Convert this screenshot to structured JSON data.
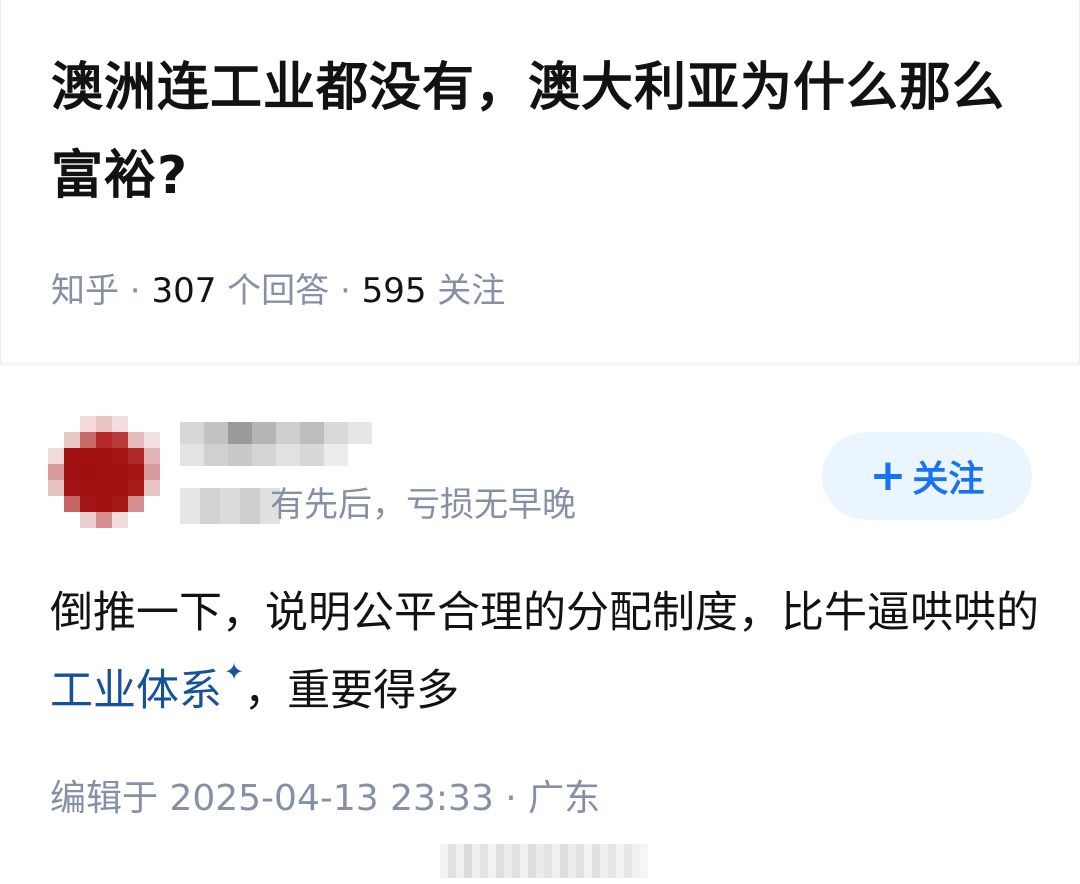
{
  "question": {
    "title": "澳洲连工业都没有，澳大利亚为什么那么富裕?",
    "source": "知乎",
    "sep1": " · ",
    "answer_count": "307",
    "answer_label": " 个回答",
    "sep2": " · ",
    "follow_count": "595",
    "follow_label": " 关注"
  },
  "author": {
    "bio_visible": "有先后，亏损无早晚"
  },
  "follow_button": {
    "label": "关注"
  },
  "answer": {
    "text_before_link": "倒推一下，说明公平合理的分配制度，比牛逼哄哄的",
    "link_text": "工业体系",
    "text_after_link": "，重要得多",
    "edited_label": "编辑于 2025-04-13 23:33 · 广东"
  },
  "colors": {
    "accent": "#1772f6",
    "link": "#175199",
    "meta_text": "#8590a6",
    "body_text": "#121212",
    "avatar": "#a31212"
  }
}
